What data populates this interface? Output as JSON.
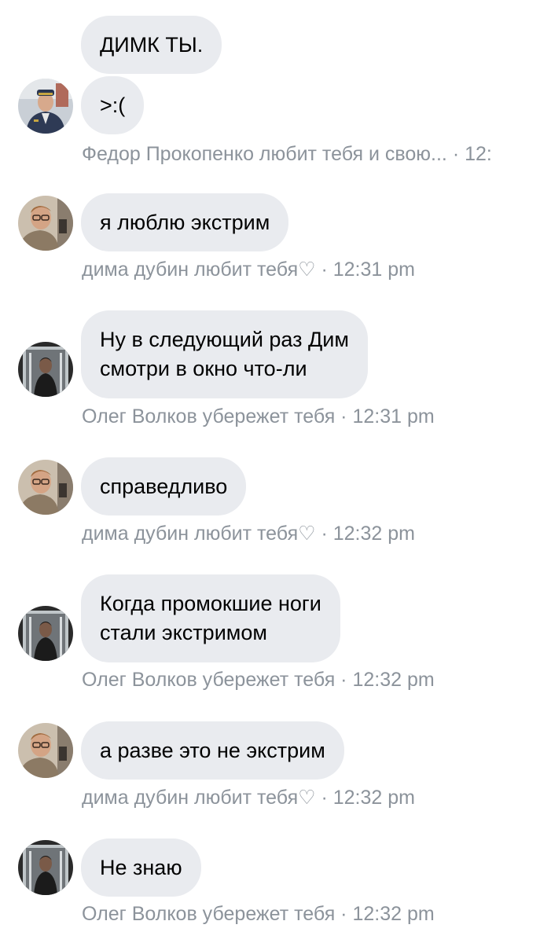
{
  "messages": [
    {
      "text": "ДИМК ТЫ."
    },
    {
      "text": ">:("
    },
    {
      "meta": "Федор Прокопенко любит тебя и свою... · 12:"
    },
    {
      "text": "я люблю экстрим"
    },
    {
      "meta": "дима дубин любит тебя♡ · 12:31 pm"
    },
    {
      "lines": [
        "Ну в следующий раз Дим",
        "смотри в окно что-ли"
      ]
    },
    {
      "meta": "Олег Волков убережет тебя · 12:31 pm"
    },
    {
      "text": "справедливо"
    },
    {
      "meta": "дима дубин любит тебя♡ · 12:32 pm"
    },
    {
      "lines": [
        "Когда промокшие ноги",
        "стали экстримом"
      ]
    },
    {
      "meta": "Олег Волков убережет тебя · 12:32 pm"
    },
    {
      "text": "а разве это не экстрим"
    },
    {
      "meta": "дима дубин любит тебя♡ · 12:32 pm"
    },
    {
      "text": "Не знаю"
    },
    {
      "meta": "Олег Волков убережет тебя · 12:32 pm"
    }
  ],
  "colors": {
    "bubble_bg": "#e9ebef",
    "meta_text": "#8c939b",
    "message_text": "#000000"
  },
  "avatars": [
    {
      "person": "Федор Прокопенко",
      "icon": "avatar-uniform-officer"
    },
    {
      "person": "дима дубин",
      "icon": "avatar-glasses-man"
    },
    {
      "person": "Олег Волков",
      "icon": "avatar-dark-doorway-man"
    }
  ]
}
